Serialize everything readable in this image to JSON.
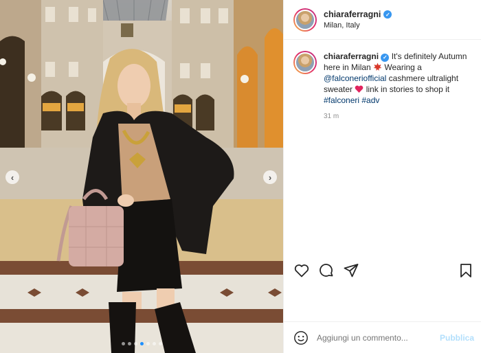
{
  "post": {
    "username": "chiaraferragni",
    "location": "Milan, Italy",
    "caption": {
      "username": "chiaraferragni",
      "text_1": " It's definitely Autumn here in Milan ",
      "text_2": " Wearing a ",
      "mention": "@falconeriofficial",
      "text_3": " cashmere ultralight sweater ",
      "text_4": " link in stories to shop it ",
      "hashtag_1": "#falconeri",
      "hashtag_2": "#adv"
    },
    "timestamp": "31 m",
    "carousel": {
      "dots": 7,
      "active_index": 3
    }
  },
  "comment": {
    "placeholder": "Aggiungi un commento...",
    "publish_label": "Pubblica"
  },
  "icons": {
    "verified": "verified-badge-icon",
    "leaf": "maple-leaf-emoji",
    "heart": "red-heart-emoji",
    "like": "heart-icon",
    "comment": "comment-icon",
    "share": "paper-plane-icon",
    "save": "bookmark-icon",
    "emoji": "smiley-icon"
  },
  "colors": {
    "verified": "#3897f0",
    "link": "#00376b",
    "publish": "#b2dffc",
    "active_dot": "#1e90ff"
  }
}
